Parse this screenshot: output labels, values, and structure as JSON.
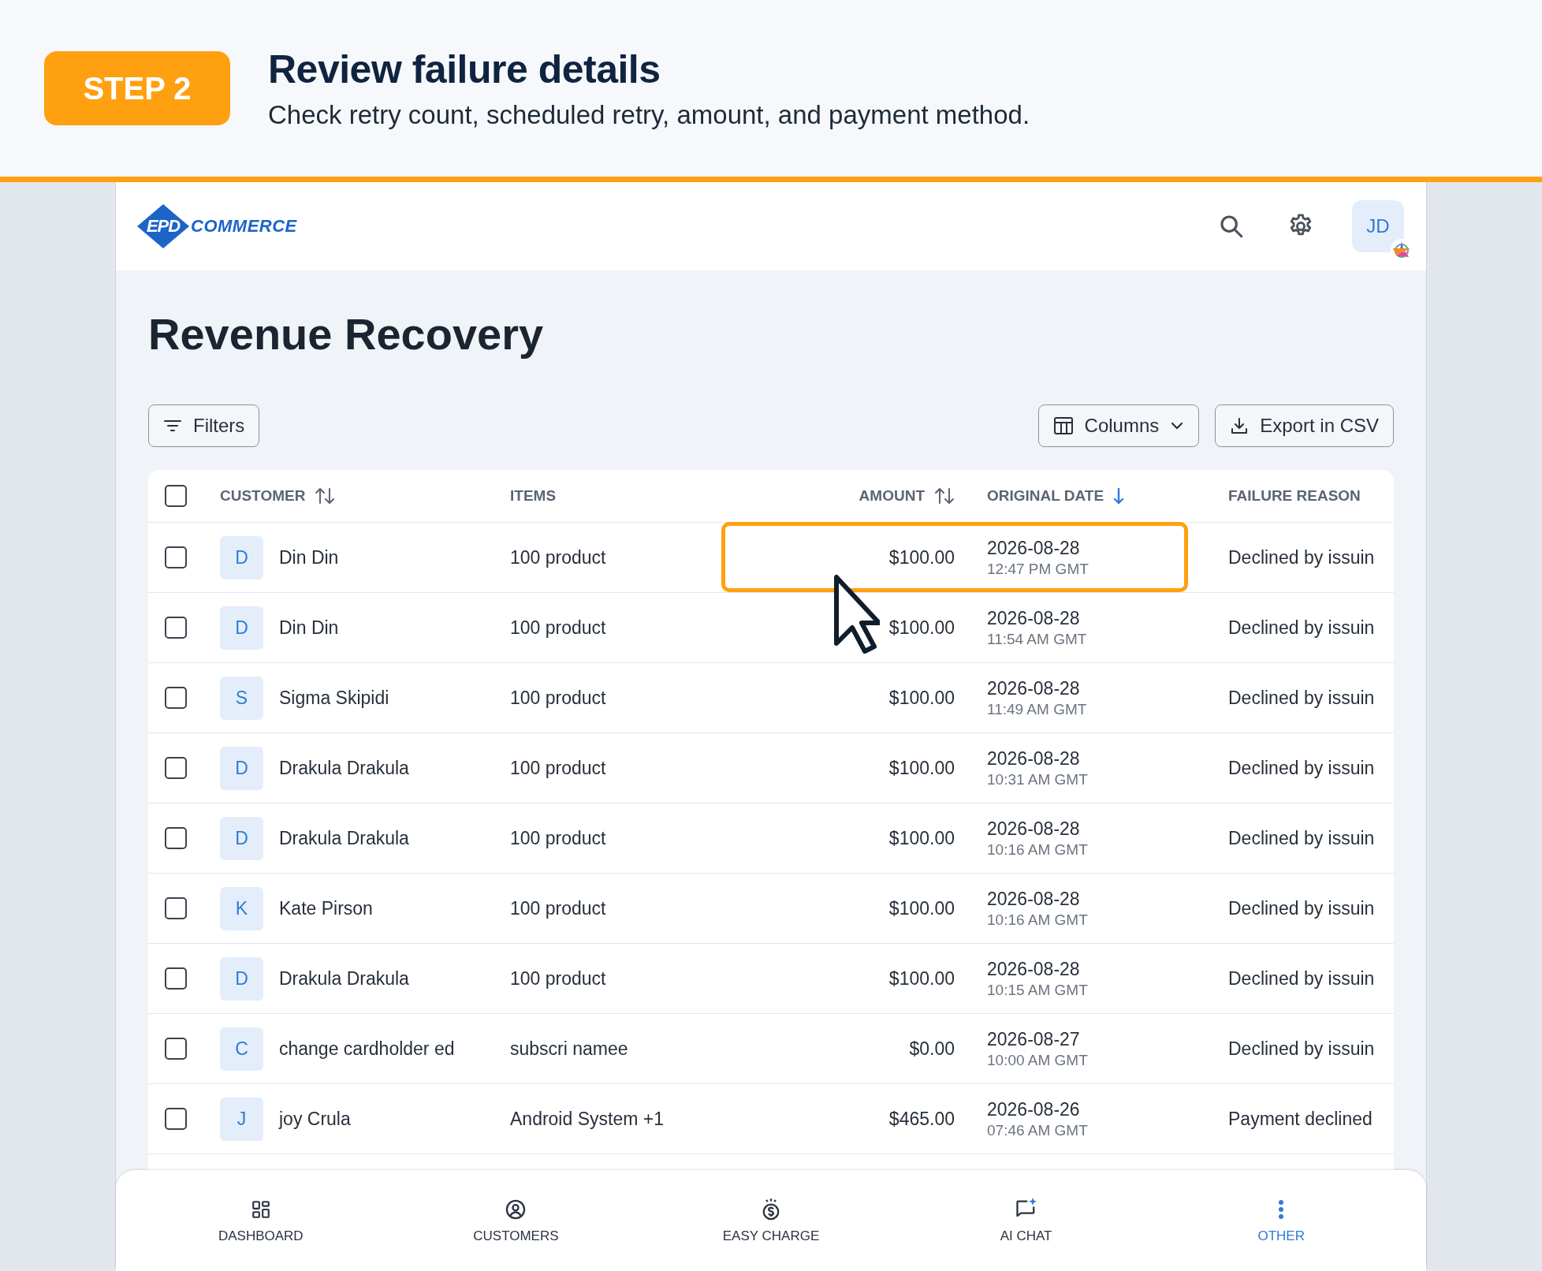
{
  "banner": {
    "step": "STEP 2",
    "title": "Review failure details",
    "subtitle": "Check retry count, scheduled retry, amount, and payment method."
  },
  "app_header": {
    "logo": {
      "mark": "EPD",
      "name": "COMMERCE"
    },
    "avatar": "JD"
  },
  "page_title": "Revenue Recovery",
  "toolbar": {
    "filters": "Filters",
    "columns": "Columns",
    "export": "Export in CSV"
  },
  "table": {
    "select_all_checked": false,
    "columns": [
      {
        "label": "CUSTOMER",
        "kind": "sortable"
      },
      {
        "label": "ITEMS",
        "kind": "plain"
      },
      {
        "label": "AMOUNT",
        "kind": "sortable"
      },
      {
        "label": "ORIGINAL DATE",
        "kind": "descending"
      },
      {
        "label": "FAILURE REASON",
        "kind": "plain"
      }
    ],
    "rows": [
      {
        "checked": false,
        "initial": "D",
        "customer": "Din Din",
        "items": "100 product",
        "amount": "$100.00",
        "date": "2026-08-28",
        "time": "12:47 PM GMT",
        "reason": "Declined by issuin",
        "highlighted": true
      },
      {
        "checked": false,
        "initial": "D",
        "customer": "Din Din",
        "items": "100 product",
        "amount": "$100.00",
        "date": "2026-08-28",
        "time": "11:54 AM GMT",
        "reason": "Declined by issuin",
        "highlighted": false
      },
      {
        "checked": false,
        "initial": "S",
        "customer": "Sigma Skipidi",
        "items": "100 product",
        "amount": "$100.00",
        "date": "2026-08-28",
        "time": "11:49 AM GMT",
        "reason": "Declined by issuin",
        "highlighted": false
      },
      {
        "checked": false,
        "initial": "D",
        "customer": "Drakula Drakula",
        "items": "100 product",
        "amount": "$100.00",
        "date": "2026-08-28",
        "time": "10:31 AM GMT",
        "reason": "Declined by issuin",
        "highlighted": false
      },
      {
        "checked": false,
        "initial": "D",
        "customer": "Drakula Drakula",
        "items": "100 product",
        "amount": "$100.00",
        "date": "2026-08-28",
        "time": "10:16 AM GMT",
        "reason": "Declined by issuin",
        "highlighted": false
      },
      {
        "checked": false,
        "initial": "K",
        "customer": "Kate Pirson",
        "items": "100 product",
        "amount": "$100.00",
        "date": "2026-08-28",
        "time": "10:16 AM GMT",
        "reason": "Declined by issuin",
        "highlighted": false
      },
      {
        "checked": false,
        "initial": "D",
        "customer": "Drakula Drakula",
        "items": "100 product",
        "amount": "$100.00",
        "date": "2026-08-28",
        "time": "10:15 AM GMT",
        "reason": "Declined by issuin",
        "highlighted": false
      },
      {
        "checked": false,
        "initial": "C",
        "customer": "change cardholder ed",
        "items": "subscri namee",
        "amount": "$0.00",
        "date": "2026-08-27",
        "time": "10:00 AM GMT",
        "reason": "Declined by issuin",
        "highlighted": false
      },
      {
        "checked": false,
        "initial": "J",
        "customer": "joy Crula",
        "items": "Android System +1",
        "amount": "$465.00",
        "date": "2026-08-26",
        "time": "07:46 AM GMT",
        "reason": "Payment declined",
        "highlighted": false
      }
    ]
  },
  "bottom_nav": [
    {
      "label": "DASHBOARD",
      "kind": "dashboard",
      "selected": false
    },
    {
      "label": "CUSTOMERS",
      "kind": "customers",
      "selected": false
    },
    {
      "label": "EASY CHARGE",
      "kind": "charge",
      "selected": false
    },
    {
      "label": "AI CHAT",
      "kind": "chat",
      "selected": false
    },
    {
      "label": "OTHER",
      "kind": "other",
      "selected": true
    }
  ]
}
